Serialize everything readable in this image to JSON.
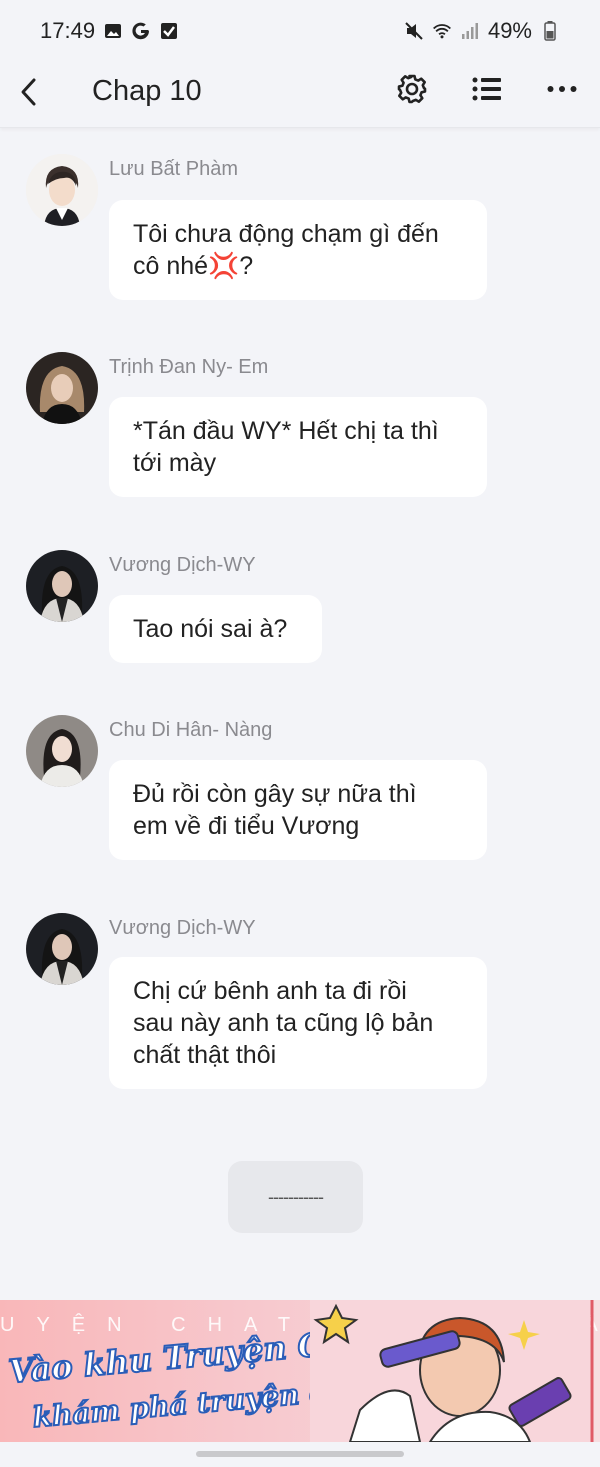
{
  "status_bar": {
    "time": "17:49",
    "battery": "49%",
    "icons": [
      "gallery-icon",
      "google-icon",
      "check-icon",
      "mute-icon",
      "wifi-icon",
      "signal-icon",
      "battery-icon"
    ]
  },
  "header": {
    "title": "Chap 10",
    "icons": [
      "back-icon",
      "gear-icon",
      "list-icon",
      "more-icon"
    ]
  },
  "messages": [
    {
      "sender": "Lưu Bất Phàm",
      "text_lines": [
        "Tôi chưa động chạm gì đến",
        "cô nhé💢?"
      ]
    },
    {
      "sender": "Trịnh Đan Ny- Em",
      "text_lines": [
        "*Tán đầu WY* Hết chị ta thì",
        "tới mày"
      ]
    },
    {
      "sender": "Vương Dịch-WY",
      "text_lines": [
        "Tao nói sai à?"
      ]
    },
    {
      "sender": "Chu Di Hân- Nàng",
      "text_lines": [
        "Đủ rồi còn gây sự nữa thì",
        "em về đi tiểu Vương"
      ]
    },
    {
      "sender": "Vương Dịch-WY",
      "text_lines": [
        "Chị cứ bênh anh ta đi rồi",
        "sau này anh ta cũng lộ bản",
        "chất thật thôi"
      ]
    }
  ],
  "divider": {
    "label": "-----------"
  },
  "banner": {
    "small_text": "UYỆN CHAT    KHÁM PHÁ",
    "line1": "Vào khu Truyện Chat,",
    "line2": "khám phá truyện chất"
  },
  "colors": {
    "background": "#f3f4f8",
    "bubble": "#ffffff",
    "sender": "#8a8a8f",
    "banner_stroke": "#2a5db8"
  }
}
